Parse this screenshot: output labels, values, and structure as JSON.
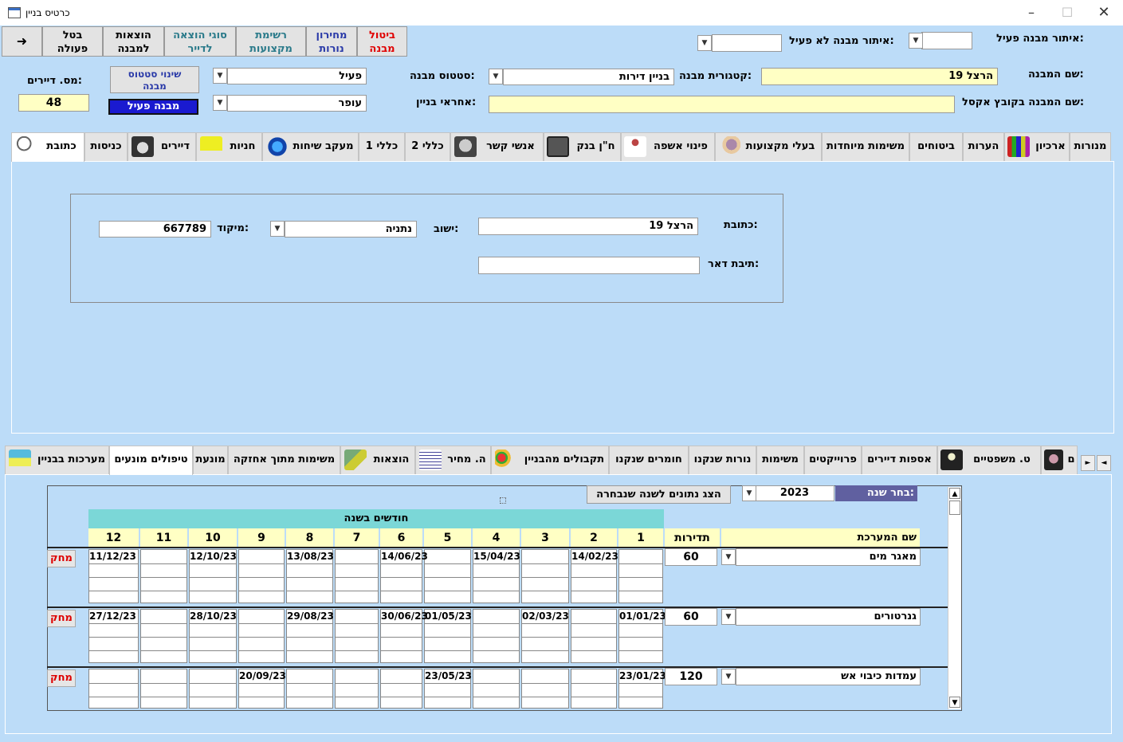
{
  "window": {
    "title": "כרטיס בניין"
  },
  "toolbar": [
    {
      "label": "ביטול\nמבנה",
      "color": "#e00000"
    },
    {
      "label": "מחירון\nנורות",
      "color": "#2a3aa8"
    },
    {
      "label": "רשימת\nמקצועות",
      "color": "#2a7a8a"
    },
    {
      "label": "סוגי הוצאה\nלדייר",
      "color": "#2a7a8a"
    },
    {
      "label": "הוצאות\nלמבנה",
      "color": "#000000"
    },
    {
      "label": "בטל\nפעולה",
      "color": "#000000"
    }
  ],
  "filters": {
    "active_label": "איתור מבנה פעיל:",
    "active_value": "",
    "inactive_label": "איתור מבנה לא פעיל:",
    "inactive_value": ""
  },
  "building": {
    "name_label": "שם המבנה:",
    "name_value": "הרצל 19",
    "category_label": "קטגורית מבנה:",
    "category_value": "בניין דירות",
    "status_label": "סטטוס מבנה:",
    "status_value": "פעיל",
    "change_status_label": "שינוי סטטוס\nמבנה",
    "active_badge": "מבנה פעיל",
    "tenants_label": "מס. דיירים:",
    "tenants_value": "48",
    "excel_label": "שם המבנה בקובץ אקסל:",
    "excel_value": "",
    "responsible_label": "אחראי בניין:",
    "responsible_value": "עופר"
  },
  "top_tabs": [
    "מנורות",
    "ארכיון",
    "הערות",
    "ביטוחים",
    "משימות מיוחדות",
    "בעלי מקצועות",
    "פינוי אשפה",
    "ח\"ן בנק",
    "אנשי קשר",
    "כללי 2",
    "כללי 1",
    "מעקב שיחות",
    "חניות",
    "דיירים",
    "כניסות",
    "כתובת"
  ],
  "address": {
    "address_label": "כתובת:",
    "address_value": "הרצל 19",
    "city_label": "ישוב:",
    "city_value": "נתניה",
    "zip_label": "מיקוד:",
    "zip_value": "667789",
    "pobox_label": "תיבת דאר:",
    "pobox_value": ""
  },
  "bottom_tabs": [
    "ם",
    "ט. משפטיים",
    "אספות דיירים",
    "פרוייקטים",
    "משימות",
    "נורות שנקנו",
    "חומרים שנקנו",
    "תקבולים מהבניין",
    "ה. מחיר",
    "הוצאות",
    "משימות מתוך אחזקה",
    "מונעת",
    "טיפולים מונעים",
    "מערכות בבניין"
  ],
  "maintenance": {
    "year_label": "בחר שנה:",
    "year_value": "2023",
    "show_button": "הצג נתונים לשנה שנבחרה",
    "months_header": "חודשים בשנה",
    "system_header": "שם המערכת",
    "freq_header": "תדירות",
    "months": [
      "1",
      "2",
      "3",
      "4",
      "5",
      "6",
      "7",
      "8",
      "9",
      "10",
      "11",
      "12"
    ],
    "delete_label": "מחק",
    "rows": [
      {
        "name": "מאגר מים",
        "freq": "60",
        "dates": [
          "",
          "14/02/23",
          "",
          "15/04/23",
          "",
          "14/06/23",
          "",
          "13/08/23",
          "",
          "12/10/23",
          "",
          "11/12/23"
        ]
      },
      {
        "name": "גנרטורים",
        "freq": "60",
        "dates": [
          "01/01/23",
          "",
          "02/03/23",
          "",
          "01/05/23",
          "30/06/23",
          "",
          "29/08/23",
          "",
          "28/10/23",
          "",
          "27/12/23"
        ]
      },
      {
        "name": "עמדות כיבוי אש",
        "freq": "120",
        "dates": [
          "23/01/23",
          "",
          "",
          "",
          "23/05/23",
          "",
          "",
          "",
          "20/09/23",
          "",
          "",
          ""
        ]
      }
    ]
  }
}
